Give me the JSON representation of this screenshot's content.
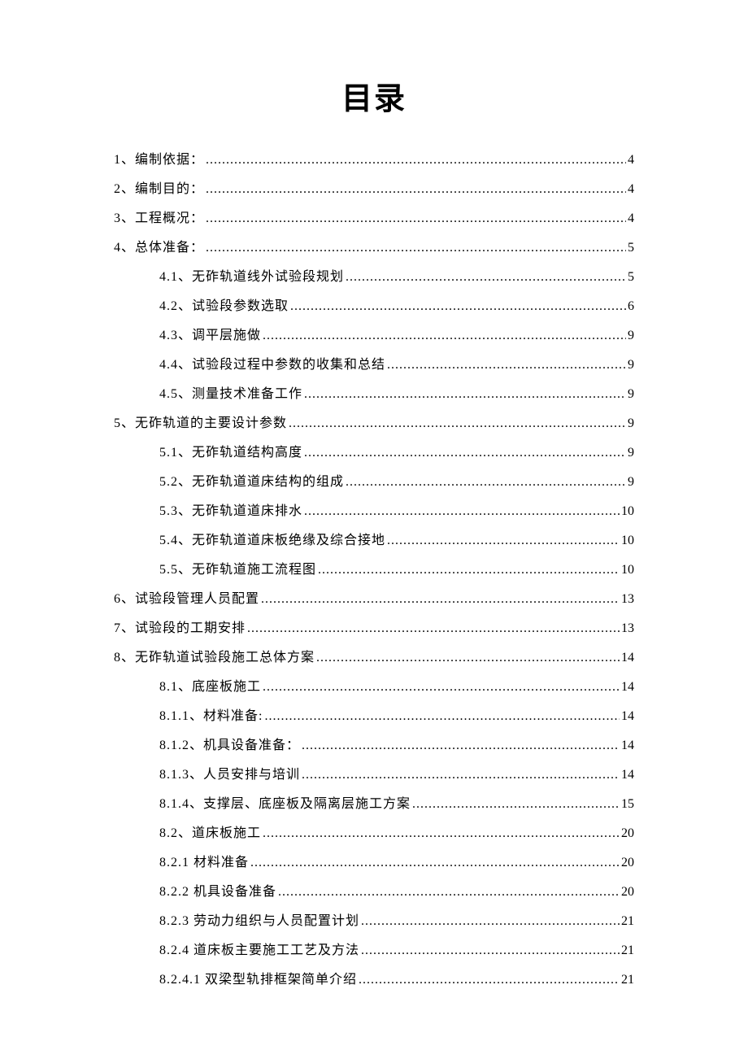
{
  "title": "目录",
  "entries": [
    {
      "level": 1,
      "label": "1、编制依据：",
      "page": "4"
    },
    {
      "level": 1,
      "label": "2、编制目的：",
      "page": "4"
    },
    {
      "level": 1,
      "label": "3、工程概况：",
      "page": "4"
    },
    {
      "level": 1,
      "label": "4、总体准备：",
      "page": "5"
    },
    {
      "level": 2,
      "label": "4.1、无砟轨道线外试验段规划",
      "page": "5"
    },
    {
      "level": 2,
      "label": "4.2、试验段参数选取",
      "page": "6"
    },
    {
      "level": 2,
      "label": "4.3、调平层施做",
      "page": "9"
    },
    {
      "level": 2,
      "label": "4.4、试验段过程中参数的收集和总结",
      "page": "9"
    },
    {
      "level": 2,
      "label": "4.5、测量技术准备工作",
      "page": "9"
    },
    {
      "level": 1,
      "label": "5、无砟轨道的主要设计参数",
      "page": "9"
    },
    {
      "level": 2,
      "label": "5.1、无砟轨道结构高度",
      "page": "9"
    },
    {
      "level": 2,
      "label": "5.2、无砟轨道道床结构的组成",
      "page": "9"
    },
    {
      "level": 2,
      "label": "5.3、无砟轨道道床排水",
      "page": "10"
    },
    {
      "level": 2,
      "label": "5.4、无砟轨道道床板绝缘及综合接地",
      "page": "10"
    },
    {
      "level": 2,
      "label": "5.5、无砟轨道施工流程图",
      "page": "10"
    },
    {
      "level": 1,
      "label": "6、试验段管理人员配置",
      "page": "13"
    },
    {
      "level": 1,
      "label": "7、试验段的工期安排",
      "page": "13"
    },
    {
      "level": 1,
      "label": "8、无砟轨道试验段施工总体方案",
      "page": "14"
    },
    {
      "level": 2,
      "label": "8.1、底座板施工",
      "page": "14"
    },
    {
      "level": 2,
      "label": "8.1.1、材料准备:",
      "page": "14"
    },
    {
      "level": 2,
      "label": "8.1.2、机具设备准备：",
      "page": "14"
    },
    {
      "level": 2,
      "label": "8.1.3、人员安排与培训",
      "page": "14"
    },
    {
      "level": 2,
      "label": "8.1.4、支撑层、底座板及隔离层施工方案",
      "page": "15"
    },
    {
      "level": 2,
      "label": "8.2、道床板施工",
      "page": "20"
    },
    {
      "level": 2,
      "label": "8.2.1 材料准备",
      "page": "20"
    },
    {
      "level": 2,
      "label": "8.2.2 机具设备准备",
      "page": "20"
    },
    {
      "level": 2,
      "label": "8.2.3 劳动力组织与人员配置计划",
      "page": "21"
    },
    {
      "level": 2,
      "label": "8.2.4 道床板主要施工工艺及方法",
      "page": "21"
    },
    {
      "level": 2,
      "label": "8.2.4.1 双梁型轨排框架简单介绍",
      "page": "21"
    }
  ]
}
